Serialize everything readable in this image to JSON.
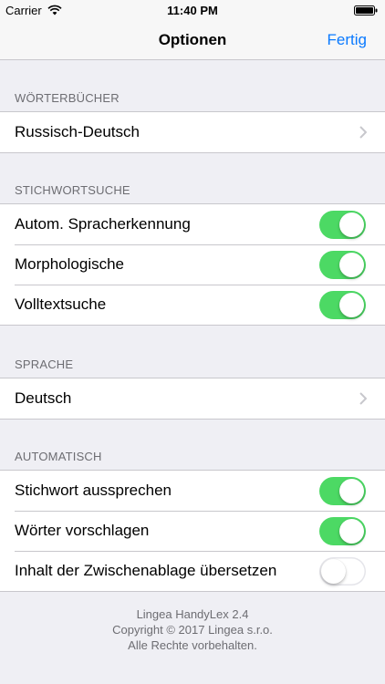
{
  "status": {
    "carrier": "Carrier",
    "time": "11:40 PM"
  },
  "nav": {
    "title": "Optionen",
    "done": "Fertig"
  },
  "sections": {
    "dictionaries": {
      "header": "WÖRTERBÜCHER",
      "rows": [
        {
          "label": "Russisch-Deutsch"
        }
      ]
    },
    "keyword_search": {
      "header": "STICHWORTSUCHE",
      "rows": [
        {
          "label": "Autom. Spracherkennung",
          "on": true
        },
        {
          "label": "Morphologische",
          "on": true
        },
        {
          "label": "Volltextsuche",
          "on": true
        }
      ]
    },
    "language": {
      "header": "SPRACHE",
      "rows": [
        {
          "label": "Deutsch"
        }
      ]
    },
    "automatic": {
      "header": "AUTOMATISCH",
      "rows": [
        {
          "label": "Stichwort aussprechen",
          "on": true
        },
        {
          "label": "Wörter vorschlagen",
          "on": true
        },
        {
          "label": "Inhalt der Zwischenablage übersetzen",
          "on": false
        }
      ]
    }
  },
  "footer": {
    "line1": "Lingea HandyLex 2.4",
    "line2": "Copyright © 2017 Lingea s.r.o.",
    "line3": "Alle Rechte vorbehalten."
  },
  "colors": {
    "accent": "#0a7aff",
    "toggle_on": "#4cd964",
    "background": "#efeff4"
  },
  "icons": [
    "wifi-icon",
    "battery-icon",
    "chevron-right-icon"
  ]
}
